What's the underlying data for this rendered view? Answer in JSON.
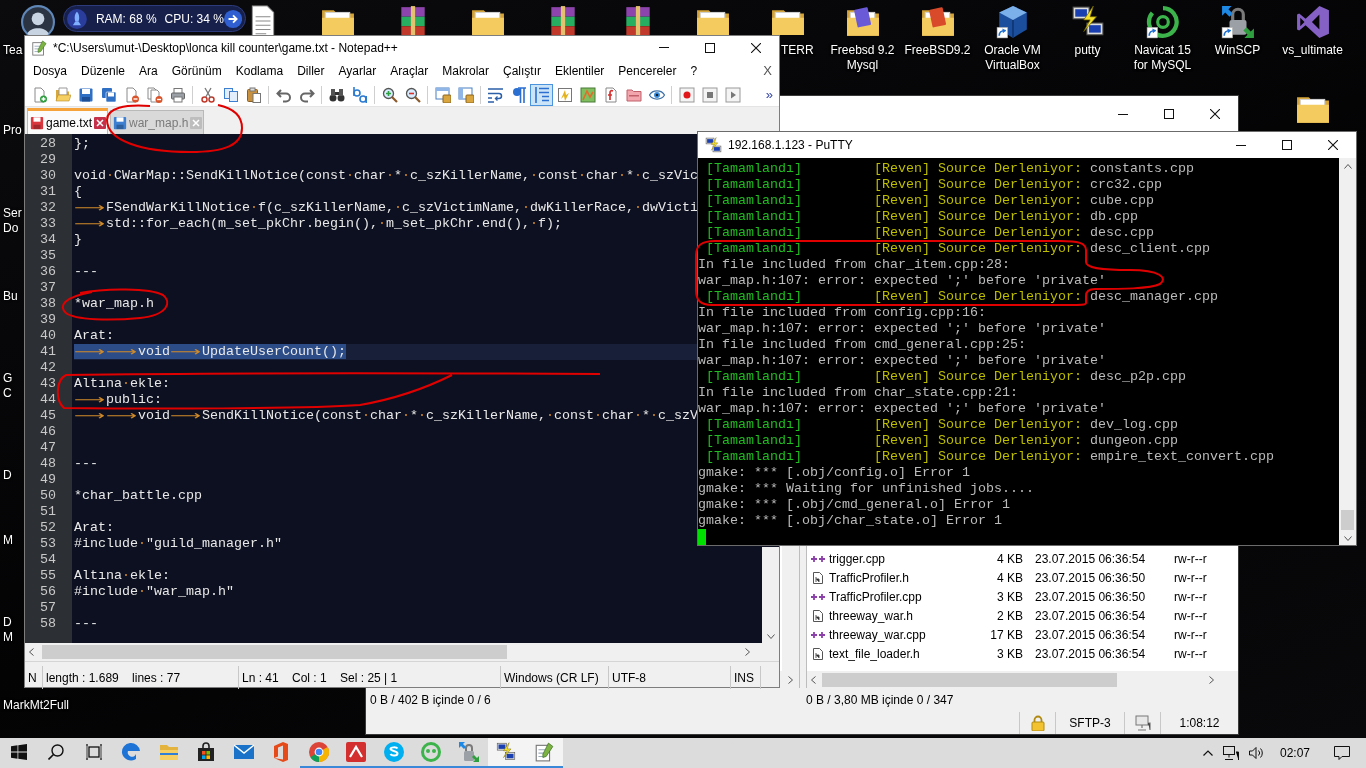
{
  "desktop": {
    "system_monitor": {
      "ram": "RAM: 68 %",
      "cpu": "CPU: 34 %"
    },
    "icons": [
      {
        "kind": "avatar",
        "label": "Tea",
        "shortcut": false
      },
      {
        "kind": "document",
        "shortcut": false
      },
      {
        "kind": "folder",
        "shortcut": false
      },
      {
        "kind": "archive",
        "shortcut": false
      },
      {
        "kind": "folder",
        "shortcut": false
      },
      {
        "kind": "archive",
        "shortcut": false
      },
      {
        "kind": "archive",
        "shortcut": false
      },
      {
        "kind": "folder",
        "shortcut": false
      },
      {
        "kind": "folder",
        "label": "TERR",
        "shortcut": false
      },
      {
        "kind": "folder-violet-box",
        "label": "Freebsd 9.2 Mysql",
        "shortcut": false
      },
      {
        "kind": "folder-red-box",
        "label": "FreeBSD9.2",
        "shortcut": false
      },
      {
        "kind": "cube",
        "label": "Oracle VM VirtualBox",
        "shortcut": true
      },
      {
        "kind": "terminals",
        "label": "putty",
        "shortcut": false
      },
      {
        "kind": "ring",
        "label": "Navicat 15 for MySQL",
        "shortcut": true
      },
      {
        "kind": "padlock",
        "label": "WinSCP",
        "shortcut": true
      },
      {
        "kind": "ribbon",
        "label": "vs_ultimate",
        "shortcut": false
      },
      {
        "kind": "folder",
        "shortcut": false
      }
    ],
    "left_labels": [
      "Pro",
      "Ser",
      "Do",
      "Bu",
      "G",
      "C",
      "D",
      "M",
      "D",
      "M",
      "MarkMt2Full"
    ]
  },
  "notepad": {
    "title": "*C:\\Users\\umut-\\Desktop\\lonca kill counter\\game.txt - Notepad++",
    "menu": [
      "Dosya",
      "Düzenle",
      "Ara",
      "Görünüm",
      "Kodlama",
      "Diller",
      "Ayarlar",
      "Araçlar",
      "Makrolar",
      "Çalıştır",
      "Eklentiler",
      "Pencereler",
      "?"
    ],
    "menu_close": "X",
    "toolbar": [
      [
        {
          "kind": "new",
          "on": false
        },
        {
          "kind": "open",
          "on": false
        },
        {
          "kind": "save",
          "on": false
        },
        {
          "kind": "save-all",
          "on": false
        },
        {
          "kind": "close",
          "on": false
        },
        {
          "kind": "close-all",
          "on": false
        },
        {
          "kind": "print",
          "on": false
        }
      ],
      [
        {
          "kind": "cut",
          "on": false
        },
        {
          "kind": "copy",
          "on": false
        },
        {
          "kind": "paste",
          "on": false
        }
      ],
      [
        {
          "kind": "undo",
          "on": false
        },
        {
          "kind": "redo",
          "on": false
        }
      ],
      [
        {
          "kind": "find",
          "on": false
        },
        {
          "kind": "replace",
          "on": false
        }
      ],
      [
        {
          "kind": "zoom-in",
          "on": false
        },
        {
          "kind": "zoom-out",
          "on": false
        }
      ],
      [
        {
          "kind": "sync-v",
          "on": false
        },
        {
          "kind": "sync-h",
          "on": false
        }
      ],
      [
        {
          "kind": "wrap",
          "on": false
        },
        {
          "kind": "all-chars",
          "on": false
        },
        {
          "kind": "indent-guide",
          "on": true
        },
        {
          "kind": "language",
          "on": false
        },
        {
          "kind": "doc-map",
          "on": false
        },
        {
          "kind": "function-list",
          "on": false
        },
        {
          "kind": "folder-workspace",
          "on": false
        },
        {
          "kind": "monitor",
          "on": false
        }
      ],
      [
        {
          "kind": "record",
          "on": false
        },
        {
          "kind": "stop",
          "on": false
        },
        {
          "kind": "play",
          "on": false
        }
      ]
    ],
    "toolbar_more": "»",
    "tabs": [
      {
        "label": "game.txt",
        "selected": true,
        "modified": true
      },
      {
        "label": "war_map.h",
        "selected": false,
        "modified": false
      }
    ],
    "lines": [
      {
        "number": "28",
        "text": "};",
        "selected": false
      },
      {
        "number": "29",
        "selected": false
      },
      {
        "number": "30",
        "text": "void·CWarMap::SendKillNotice(const·char·*·c_szKillerName,·const·char·*·c_szVic",
        "selected": false
      },
      {
        "number": "31",
        "text": "{",
        "selected": false
      },
      {
        "number": "32",
        "text": "⟶FSendWarKillNotice·f(c_szKillerName,·c_szVictimName,·dwKillerRace,·dwVicti",
        "selected": false
      },
      {
        "number": "33",
        "text": "⟶std::for_each(m_set_pkChr.begin(),·m_set_pkChr.end(),·f);",
        "selected": false
      },
      {
        "number": "34",
        "text": "}",
        "selected": false
      },
      {
        "number": "35",
        "selected": false
      },
      {
        "number": "36",
        "text": "---",
        "selected": false
      },
      {
        "number": "37",
        "selected": false
      },
      {
        "number": "38",
        "text": "*war_map.h",
        "selected": false
      },
      {
        "number": "39",
        "selected": false
      },
      {
        "number": "40",
        "text": "Arat:",
        "selected": false
      },
      {
        "number": "41",
        "text": "⟶⟶void⟶UpdateUserCount();",
        "selected": true
      },
      {
        "number": "42",
        "selected": false
      },
      {
        "number": "43",
        "text": "Altına·ekle:",
        "selected": false
      },
      {
        "number": "44",
        "text": "⟶public:",
        "selected": false
      },
      {
        "number": "45",
        "text": "⟶⟶void⟶SendKillNotice(const·char·*·c_szKillerName,·const·char·*·c_szV",
        "selected": false
      },
      {
        "number": "46",
        "selected": false
      },
      {
        "number": "47",
        "selected": false
      },
      {
        "number": "48",
        "text": "---",
        "selected": false
      },
      {
        "number": "49",
        "selected": false
      },
      {
        "number": "50",
        "text": "*char_battle.cpp",
        "selected": false
      },
      {
        "number": "51",
        "selected": false
      },
      {
        "number": "52",
        "text": "Arat:",
        "selected": false
      },
      {
        "number": "53",
        "text": "#include·\"guild_manager.h\"",
        "selected": false
      },
      {
        "number": "54",
        "selected": false
      },
      {
        "number": "55",
        "text": "Altına·ekle:",
        "selected": false
      },
      {
        "number": "56",
        "text": "#include·\"war_map.h\"",
        "selected": false
      },
      {
        "number": "57",
        "selected": false
      },
      {
        "number": "58",
        "text": "---",
        "selected": false
      }
    ],
    "status": [
      "N",
      "length : 1.689    lines : 77",
      "Ln : 41    Col : 1    Sel : 25 | 1",
      "Windows (CR LF)",
      "UTF-8",
      "INS"
    ]
  },
  "putty": {
    "title": "192.168.1.123 - PuTTY",
    "lines": [
      {
        "kind": "build",
        "status": "[Tamamlandı]",
        "action": "[Reven] Source Derleniyor:",
        "file": "constants.cpp"
      },
      {
        "kind": "build",
        "status": "[Tamamlandı]",
        "action": "[Reven] Source Derleniyor:",
        "file": "crc32.cpp"
      },
      {
        "kind": "build",
        "status": "[Tamamlandı]",
        "action": "[Reven] Source Derleniyor:",
        "file": "cube.cpp"
      },
      {
        "kind": "build",
        "status": "[Tamamlandı]",
        "action": "[Reven] Source Derleniyor:",
        "file": "db.cpp"
      },
      {
        "kind": "build",
        "status": "[Tamamlandı]",
        "action": "[Reven] Source Derleniyor:",
        "file": "desc.cpp"
      },
      {
        "kind": "build",
        "status": "[Tamamlandı]",
        "action": "[Reven] Source Derleniyor:",
        "file": "desc_client.cpp"
      },
      {
        "kind": "plain",
        "text": "In file included from char_item.cpp:28:"
      },
      {
        "kind": "plain",
        "text": "war_map.h:107: error: expected ';' before 'private'"
      },
      {
        "kind": "build",
        "status": "[Tamamlandı]",
        "action": "[Reven] Source Derleniyor:",
        "file": "desc_manager.cpp"
      },
      {
        "kind": "plain",
        "text": "In file included from config.cpp:16:"
      },
      {
        "kind": "plain",
        "text": "war_map.h:107: error: expected ';' before 'private'"
      },
      {
        "kind": "plain",
        "text": "In file included from cmd_general.cpp:25:"
      },
      {
        "kind": "plain",
        "text": "war_map.h:107: error: expected ';' before 'private'"
      },
      {
        "kind": "build",
        "status": "[Tamamlandı]",
        "action": "[Reven] Source Derleniyor:",
        "file": "desc_p2p.cpp"
      },
      {
        "kind": "plain",
        "text": "In file included from char_state.cpp:21:"
      },
      {
        "kind": "plain",
        "text": "war_map.h:107: error: expected ';' before 'private'"
      },
      {
        "kind": "build",
        "status": "[Tamamlandı]",
        "action": "[Reven] Source Derleniyor:",
        "file": "dev_log.cpp"
      },
      {
        "kind": "build",
        "status": "[Tamamlandı]",
        "action": "[Reven] Source Derleniyor:",
        "file": "dungeon.cpp"
      },
      {
        "kind": "build",
        "status": "[Tamamlandı]",
        "action": "[Reven] Source Derleniyor:",
        "file": "empire_text_convert.cpp"
      },
      {
        "kind": "plain",
        "text": "gmake: *** [.obj/config.o] Error 1"
      },
      {
        "kind": "plain",
        "text": "gmake: *** Waiting for unfinished jobs...."
      },
      {
        "kind": "plain",
        "text": "gmake: *** [.obj/cmd_general.o] Error 1"
      },
      {
        "kind": "plain",
        "text": "gmake: *** [.obj/char_state.o] Error 1"
      }
    ]
  },
  "winscp": {
    "files": [
      {
        "kind": "cpp",
        "name": "trigger.cpp",
        "size": "4 KB",
        "changed": "23.07.2015 06:36:54",
        "rights": "rw-r--r"
      },
      {
        "kind": "h",
        "name": "TrafficProfiler.h",
        "size": "4 KB",
        "changed": "23.07.2015 06:36:50",
        "rights": "rw-r--r"
      },
      {
        "kind": "cpp",
        "name": "TrafficProfiler.cpp",
        "size": "3 KB",
        "changed": "23.07.2015 06:36:50",
        "rights": "rw-r--r"
      },
      {
        "kind": "h",
        "name": "threeway_war.h",
        "size": "2 KB",
        "changed": "23.07.2015 06:36:54",
        "rights": "rw-r--r"
      },
      {
        "kind": "cpp",
        "name": "threeway_war.cpp",
        "size": "17 KB",
        "changed": "23.07.2015 06:36:54",
        "rights": "rw-r--r"
      },
      {
        "kind": "h",
        "name": "text_file_loader.h",
        "size": "3 KB",
        "changed": "23.07.2015 06:36:54",
        "rights": "rw-r--r"
      }
    ],
    "left_status": "0 B / 402 B içinde 0 / 6",
    "right_status": "0 B / 3,80 MB içinde 0 / 347",
    "protocol": "SFTP-3",
    "elapsed": "1:08:12"
  },
  "taskbar": {
    "apps": [
      {
        "kind": "swirl",
        "running": false,
        "active": false
      },
      {
        "kind": "folder",
        "running": false,
        "active": false
      },
      {
        "kind": "bag",
        "running": false,
        "active": false
      },
      {
        "kind": "envelope",
        "running": false,
        "active": false
      },
      {
        "kind": "panel",
        "running": false,
        "active": false
      },
      {
        "kind": "wheel",
        "running": true,
        "active": false
      },
      {
        "kind": "tile",
        "running": true,
        "active": false
      },
      {
        "kind": "s-circle",
        "running": true,
        "active": false
      },
      {
        "kind": "ring",
        "running": true,
        "active": false
      },
      {
        "kind": "padlock",
        "running": true,
        "active": false
      },
      {
        "kind": "terminals",
        "running": true,
        "active": true
      },
      {
        "kind": "notepad",
        "running": true,
        "active": true
      }
    ],
    "clock": "02:07"
  }
}
